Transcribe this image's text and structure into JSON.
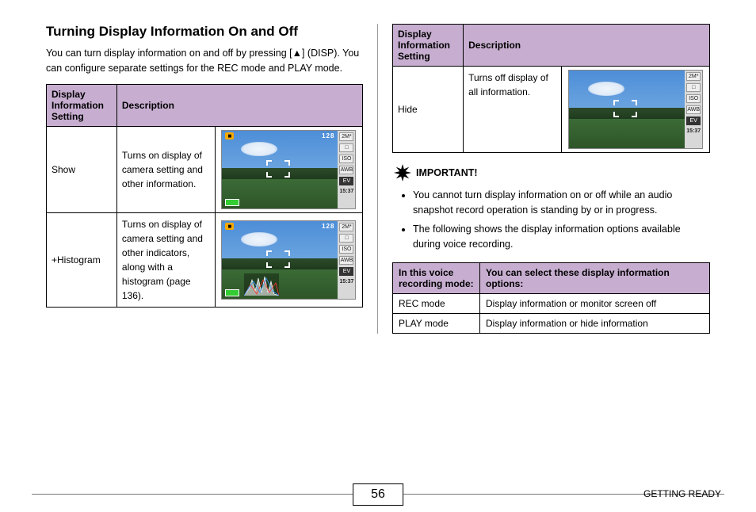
{
  "title": "Turning Display Information On and Off",
  "intro": "You can turn display information on and off by pressing [▲] (DISP). You can configure separate settings for the REC mode and PLAY mode.",
  "table_headers": {
    "setting": "Display Information Setting",
    "desc": "Description"
  },
  "rows": [
    {
      "name": "Show",
      "desc": "Turns on display of camera setting and other information.",
      "histogram": false,
      "overlay": true
    },
    {
      "name": "+Histogram",
      "desc": "Turns on display of camera setting and other indicators, along with a histogram (page 136).",
      "histogram": true,
      "overlay": true
    },
    {
      "name": "Hide",
      "desc": "Turns off display of all information.",
      "histogram": false,
      "overlay": false
    }
  ],
  "camera_overlay": {
    "rec_badge": "■",
    "count": "128",
    "side_items": [
      "2M*",
      "□",
      "ISO",
      "AWB",
      "EV"
    ],
    "time": "15:37"
  },
  "important_label": "IMPORTANT!",
  "important_points": [
    "You cannot turn display information on or off while an audio snapshot record operation is standing by or in progress.",
    "The following shows the display information options available during voice recording."
  ],
  "voice_table": {
    "h1": "In this voice recording mode:",
    "h2": "You can select these display information options:",
    "rows": [
      {
        "mode": "REC mode",
        "options": "Display information or monitor screen off"
      },
      {
        "mode": "PLAY mode",
        "options": "Display information or hide information"
      }
    ]
  },
  "page_number": "56",
  "section_label": "GETTING READY"
}
